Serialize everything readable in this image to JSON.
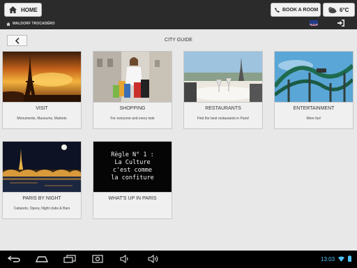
{
  "header": {
    "home_label": "HOME",
    "hotel_name": "WALDORF TROCADÉRO",
    "book_label": "BOOK A ROOM",
    "weather_temp": "6°C"
  },
  "page": {
    "title": "CITY GUIDE"
  },
  "cards": [
    {
      "title": "VISIT",
      "subtitle": "Monuments, Museums, Markets"
    },
    {
      "title": "SHOPPING",
      "subtitle": "For everyone and every look"
    },
    {
      "title": "RESTAURANTS",
      "subtitle": "Find the best restaurants in Paris!"
    },
    {
      "title": "ENTERTAINMENT",
      "subtitle": "More fun!"
    },
    {
      "title": "PARIS BY NIGHT",
      "subtitle": "Cabarets, Opera, Night clubs & Bars"
    },
    {
      "title": "WHAT'S UP IN PARIS",
      "subtitle": "",
      "image_text": [
        "Règle N° 1 :",
        "La Culture",
        "c'est comme",
        "la confiture"
      ]
    }
  ],
  "status_bar": {
    "time": "13:03"
  },
  "colors": {
    "header_bg": "#2b2b2b",
    "page_bg": "#e8e8e8",
    "clock": "#4fc3f7"
  }
}
